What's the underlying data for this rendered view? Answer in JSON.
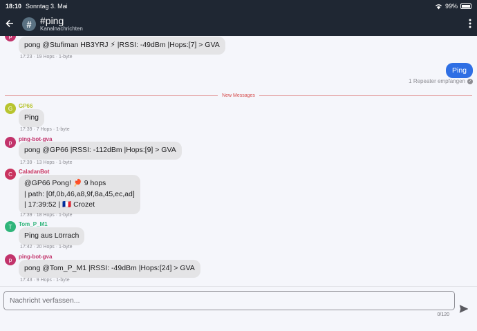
{
  "status": {
    "time": "18:10",
    "date": "Sonntag 3. Mai",
    "battery": "99%"
  },
  "header": {
    "title": "#ping",
    "subtitle": "Kanalnachrichten",
    "channel_glyph": "#"
  },
  "messages": [
    {
      "initial": "p",
      "sender": "",
      "sender_color": "#c2336b",
      "lines": [
        "pong @Stufiman HB3YRJ ⚡  |RSSI: -49dBm |Hops:[7] > GVA"
      ],
      "meta": "17:23 · 19 Hops · 1-byte"
    },
    {
      "initial": "G",
      "sender": "GP66",
      "sender_color": "#b8c42f",
      "lines": [
        "Ping"
      ],
      "meta": "17:39 · 7 Hops · 1-byte"
    },
    {
      "initial": "p",
      "sender": "ping-bot-gva",
      "sender_color": "#c2336b",
      "lines": [
        "pong @GP66 |RSSI: -112dBm |Hops:[9] > GVA"
      ],
      "meta": "17:39 · 13 Hops · 1-byte"
    },
    {
      "initial": "C",
      "sender": "CaladanBot",
      "sender_color": "#c9335f",
      "lines": [
        "@GP66  Pong! 🏓 9 hops",
        "| path: [0f,0b,46,a8,9f,8a,45,ec,ad]",
        "| 17:39:52 | 🇫🇷 Crozet"
      ],
      "meta": "17:39 · 18 Hops · 1-byte"
    },
    {
      "initial": "T",
      "sender": "Tom_P_M1",
      "sender_color": "#2fb57a",
      "lines": [
        "Ping aus Lörrach"
      ],
      "meta": "17:42 · 20 Hops · 1-byte"
    },
    {
      "initial": "p",
      "sender": "ping-bot-gva",
      "sender_color": "#c2336b",
      "lines": [
        "pong @Tom_P_M1 |RSSI: -49dBm |Hops:[24] > GVA"
      ],
      "meta": "17:43 · 9 Hops · 1-byte"
    }
  ],
  "outgoing": {
    "text": "Ping",
    "status": "1 Repeater empfangen"
  },
  "divider": {
    "label": "New Messages"
  },
  "composer": {
    "placeholder": "Nachricht verfassen...",
    "counter": "0/120"
  },
  "colors": {
    "header_bg": "#1f2733",
    "accent": "#2f6fe4",
    "divider": "#d44747"
  }
}
